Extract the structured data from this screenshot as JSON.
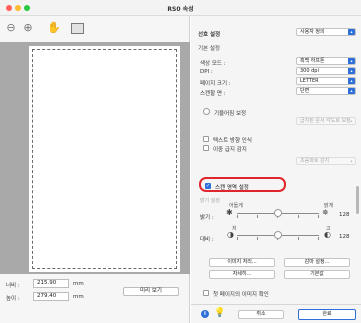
{
  "window": {
    "title": "RS0 속성",
    "traffic_lights": {
      "close": "#ff5f57",
      "minimize": "#febc2e",
      "zoom": "#28c840"
    }
  },
  "toolbar": {
    "icons": [
      "zoom-out-icon",
      "zoom-in-icon",
      "hand-icon",
      "crop-rect-icon"
    ]
  },
  "scan_area": {
    "width_label": "너비 :",
    "width_value": "215.90",
    "width_unit": "mm",
    "height_label": "높이 :",
    "height_value": "279.40",
    "height_unit": "mm",
    "preview_button": "미리 보기"
  },
  "settings": {
    "preset_label": "선호 설정",
    "preset_value": "사용자 정의",
    "basic_label": "기본 설정",
    "color_mode_label": "색상 모드 :",
    "color_mode_value": "흑백 하프톤",
    "dpi_label": "DPI :",
    "dpi_value": "300 dpi",
    "page_size_label": "페이지 크기 :",
    "page_size_value": "LETTER",
    "scan_side_label": "스캔할 면 :",
    "scan_side_value": "단면",
    "deskew_label": "기울어짐 보정",
    "deskew_option_value": "급지된 문서 각도로 보정",
    "text_orientation_label": "텍스트 방향 인식",
    "double_feed_label": "이중 급지 감지",
    "double_feed_option_value": "초음파로 감지",
    "scan_area_label": "스캔 영역 설정",
    "scan_area_checked": true,
    "sliders_section_label": "밝기 설정",
    "brightness": {
      "label": "밝기 :",
      "left_text": "어둡게",
      "right_text": "밝게",
      "value": "128"
    },
    "contrast": {
      "label": "대비 :",
      "left_text": "저",
      "right_text": "고",
      "value": "128"
    },
    "image_processing_button": "이미지 처리...",
    "gamma_button": "감마 설정...",
    "detail_button": "자세히...",
    "default_button": "기본값",
    "first_page_confirm_label": "첫 페이지의 이미지 확인"
  },
  "footer": {
    "cancel_button": "취소",
    "ok_button": "완료"
  }
}
